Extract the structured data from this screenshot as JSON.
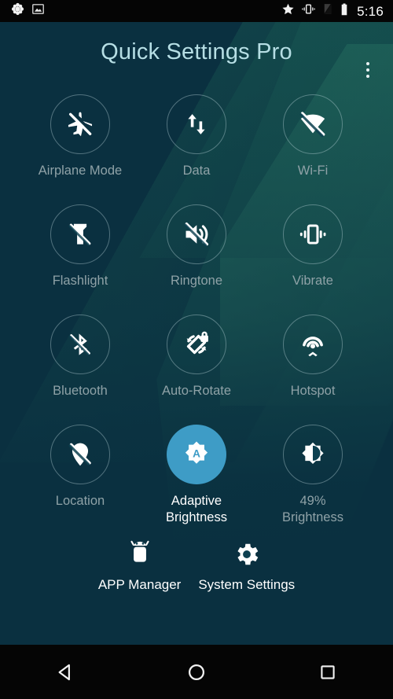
{
  "status_bar": {
    "left_icons": [
      {
        "name": "flower-notification-icon",
        "glyph": "flower"
      },
      {
        "name": "image-notification-icon",
        "glyph": "image"
      }
    ],
    "right_icons": [
      {
        "name": "star-icon",
        "glyph": "star"
      },
      {
        "name": "vibrate-icon",
        "glyph": "vibrate"
      },
      {
        "name": "sim-off-icon",
        "glyph": "sim-off"
      },
      {
        "name": "battery-full-icon",
        "glyph": "battery"
      }
    ],
    "clock": "5:16"
  },
  "app": {
    "title": "Quick Settings Pro",
    "title_color": "#b6dee4",
    "accent_color": "#3e9cc6",
    "background_color": "#0a3040",
    "label_color": "#8fa2a7",
    "overflow_menu": "more-options"
  },
  "tiles": [
    {
      "id": "airplane-mode",
      "label": "Airplane Mode",
      "icon": "airplane-off-icon",
      "active": false
    },
    {
      "id": "data",
      "label": "Data",
      "icon": "data-arrows-icon",
      "active": false
    },
    {
      "id": "wifi",
      "label": "Wi-Fi",
      "icon": "wifi-off-icon",
      "active": false
    },
    {
      "id": "flashlight",
      "label": "Flashlight",
      "icon": "flashlight-off-icon",
      "active": false
    },
    {
      "id": "ringtone",
      "label": "Ringtone",
      "icon": "volume-off-icon",
      "active": false
    },
    {
      "id": "vibrate",
      "label": "Vibrate",
      "icon": "vibrate-icon",
      "active": false
    },
    {
      "id": "bluetooth",
      "label": "Bluetooth",
      "icon": "bluetooth-off-icon",
      "active": false
    },
    {
      "id": "auto-rotate",
      "label": "Auto-Rotate",
      "icon": "rotation-locked-icon",
      "active": false
    },
    {
      "id": "hotspot",
      "label": "Hotspot",
      "icon": "hotspot-icon",
      "active": false
    },
    {
      "id": "location",
      "label": "Location",
      "icon": "location-off-icon",
      "active": false
    },
    {
      "id": "adaptive-brightness",
      "label": "Adaptive\nBrightness",
      "label_line1": "Adaptive",
      "label_line2": "Brightness",
      "icon": "brightness-auto-icon",
      "active": true
    },
    {
      "id": "brightness",
      "label": "49%\nBrightness",
      "label_line1": "49%",
      "label_line2": "Brightness",
      "icon": "brightness-icon",
      "active": false,
      "value": "49%"
    }
  ],
  "shortcuts": [
    {
      "id": "app-manager",
      "label": "APP Manager",
      "icon": "android-robot-icon"
    },
    {
      "id": "system-settings",
      "label": "System Settings",
      "icon": "gear-icon"
    }
  ],
  "nav_bar": {
    "back": "back-triangle-icon",
    "home": "home-circle-icon",
    "recents": "recents-square-icon"
  }
}
